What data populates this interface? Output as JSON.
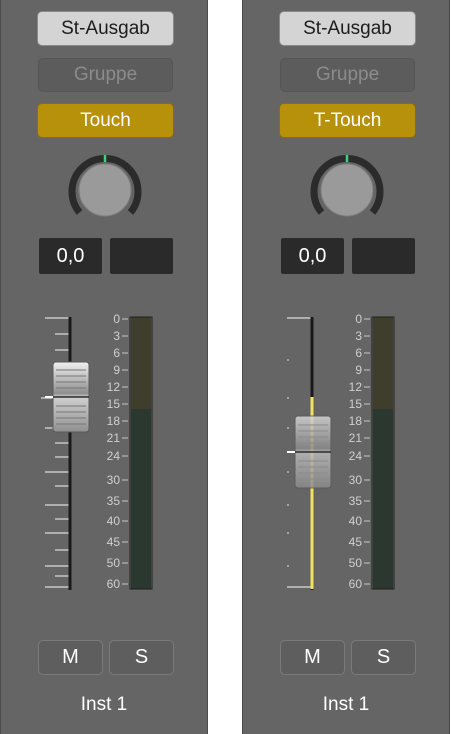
{
  "strips": [
    {
      "output": "St-Ausgab",
      "group": "Gruppe",
      "automation": "Touch",
      "volume": "0,0",
      "peak": "",
      "mute": "M",
      "solo": "S",
      "name": "Inst 1"
    },
    {
      "output": "St-Ausgab",
      "group": "Gruppe",
      "automation": "T-Touch",
      "volume": "0,0",
      "peak": "",
      "mute": "M",
      "solo": "S",
      "name": "Inst 1"
    }
  ],
  "meter_scale": [
    "0",
    "3",
    "6",
    "9",
    "12",
    "15",
    "18",
    "21",
    "24",
    "30",
    "35",
    "40",
    "45",
    "50",
    "60"
  ],
  "colors": {
    "strip_bg": "#656565",
    "automation_touch": "#b8910a",
    "automation_line": "#f2e15a",
    "pan_indicator": "#3fd17c"
  },
  "icons": [
    "pan-knob-icon",
    "fader-cap-icon"
  ]
}
